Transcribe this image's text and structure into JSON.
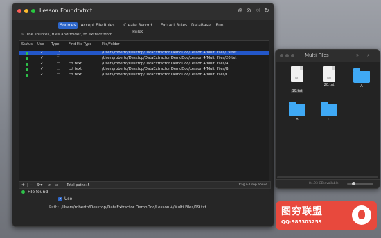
{
  "colors": {
    "accent": "#2d66c9",
    "selection": "#2357c9",
    "status_green": "#2ec24a",
    "folder_blue": "#3fa9f5"
  },
  "main_window": {
    "title": "Lesson Four.dtxtrct",
    "toolbar_icons": [
      "add-icon",
      "no-icon",
      "filter-icon",
      "sync-icon"
    ],
    "tabs": [
      {
        "label": "Sources",
        "active": true
      },
      {
        "label": "Accept File Rules",
        "active": false
      },
      {
        "label": "Create Record Rules",
        "active": false
      },
      {
        "label": "Extract Rules",
        "active": false
      },
      {
        "label": "DataBase",
        "active": false
      },
      {
        "label": "Run",
        "active": false
      }
    ],
    "hint": "The sources, files and folder, to extract from",
    "table": {
      "columns": [
        "Status",
        "Use",
        "Type",
        "Find File Type",
        "File/Folder"
      ],
      "rows": [
        {
          "type_icon": "file-icon",
          "find_type": "",
          "path": "/Users/roberto/Desktop/DataExtractor DemoDoc/Lesson 4/Multi Files/19.txt",
          "selected": true
        },
        {
          "type_icon": "file-icon",
          "find_type": "",
          "path": "/Users/roberto/Desktop/DataExtractor DemoDoc/Lesson 4/Multi Files/20.txt",
          "selected": false
        },
        {
          "type_icon": "folder-icon",
          "find_type": "txt text",
          "path": "/Users/roberto/Desktop/DataExtractor DemoDoc/Lesson 4/Multi Files/A",
          "selected": false
        },
        {
          "type_icon": "folder-icon",
          "find_type": "txt text",
          "path": "/Users/roberto/Desktop/DataExtractor DemoDoc/Lesson 4/Multi Files/B",
          "selected": false
        },
        {
          "type_icon": "folder-icon",
          "find_type": "txt text",
          "path": "/Users/roberto/Desktop/DataExtractor DemoDoc/Lesson 4/Multi Files/C",
          "selected": false
        }
      ]
    },
    "footer": {
      "total_paths": "Total paths: 5",
      "drag_hint": "Drag & Drop above"
    },
    "detail": {
      "status": "File found",
      "use_label": "Use",
      "path_label": "Path:",
      "path_value": "/Users/roberto/Desktop/DataExtractor DemoDoc/Lesson 4/Multi Files/19.txt"
    }
  },
  "finder": {
    "title": "Multi Files",
    "items": [
      {
        "name": "19.txt",
        "kind": "txt",
        "selected": true
      },
      {
        "name": "20.txt",
        "kind": "txt",
        "selected": false
      },
      {
        "name": "A",
        "kind": "folder",
        "selected": false
      },
      {
        "name": "B",
        "kind": "folder",
        "selected": false
      },
      {
        "name": "C",
        "kind": "folder",
        "selected": false
      }
    ],
    "doc_label": "TXT",
    "status": "84.93 GB available"
  },
  "watermark": {
    "main": "图穷联盟",
    "sub": "QQ:985303259"
  }
}
